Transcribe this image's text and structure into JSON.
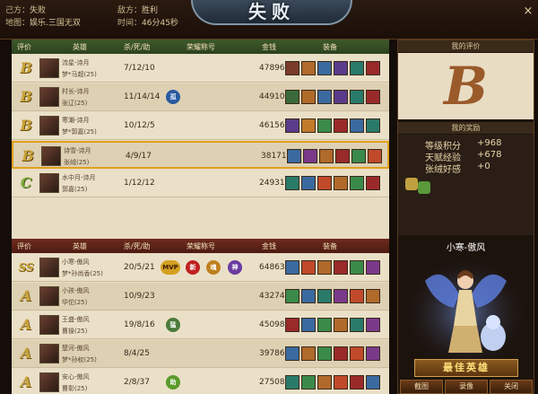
{
  "header": {
    "side_label": "己方：",
    "side_result": "失败",
    "enemy_label": "敌方：",
    "enemy_result": "胜利",
    "map_label": "地图：",
    "map_value": "娱乐.三国无双",
    "time_label": "时间：",
    "time_value": "46分45秒",
    "banner_title": "失败",
    "close_icon": "×"
  },
  "columns": {
    "rank": "评价",
    "hero": "英雄",
    "kda": "杀/死/助",
    "honor": "荣耀称号",
    "gold": "金钱",
    "equip": "装备"
  },
  "team_ally": [
    {
      "rank": "B",
      "player": "流星-诗月",
      "hero": "梦*马超(25)",
      "kda": "7/12/10",
      "gold": "47896"
    },
    {
      "rank": "B",
      "player": "村长-诗月",
      "hero": "张辽(25)",
      "kda": "11/14/14",
      "gold": "44910",
      "badge": "孤"
    },
    {
      "rank": "B",
      "player": "寒潮-诗月",
      "hero": "梦*郭嘉(25)",
      "kda": "10/12/5",
      "gold": "46156"
    },
    {
      "rank": "B",
      "player": "诗雪-诗月",
      "hero": "张绒(25)",
      "kda": "4/9/17",
      "gold": "38171"
    },
    {
      "rank": "C",
      "player": "水中月-诗月",
      "hero": "郭嘉(25)",
      "kda": "1/12/12",
      "gold": "24931"
    }
  ],
  "team_enemy": [
    {
      "rank": "SS",
      "player": "小寒-傲风",
      "hero": "梦*孙尚香(25)",
      "kda": "20/5/21",
      "gold": "64863",
      "badges": [
        "MVP",
        "新",
        "魂",
        "神"
      ]
    },
    {
      "rank": "A",
      "player": "小孩-傲风",
      "hero": "华佗(25)",
      "kda": "10/9/23",
      "gold": "43274"
    },
    {
      "rank": "A",
      "player": "王盛-傲风",
      "hero": "曹操(25)",
      "kda": "19/8/16",
      "gold": "45098",
      "badges": [
        "猛"
      ]
    },
    {
      "rank": "A",
      "player": "楚河-傲风",
      "hero": "梦*孙权(25)",
      "kda": "8/4/25",
      "gold": "39786"
    },
    {
      "rank": "A",
      "player": "安心-傲风",
      "hero": "曹彰(25)",
      "kda": "2/8/37",
      "gold": "27508",
      "badges": [
        "助"
      ]
    }
  ],
  "right_panel": {
    "my_rating_title": "我的评价",
    "my_rating": "B",
    "my_reward_title": "我的奖励",
    "rewards": [
      {
        "label": "等级积分",
        "value": "+968"
      },
      {
        "label": "天赋经验",
        "value": "+678"
      },
      {
        "label": "张绒好感",
        "value": "+0"
      }
    ],
    "mvp_hero_name": "小寒-傲风",
    "mvp_banner": "最佳英雄",
    "buttons": [
      "截图",
      "录像",
      "关闭"
    ]
  },
  "colors": {
    "panel_bg": "#e8dcc3",
    "ally_header": "#3e5a2a",
    "enemy_header": "#6e2a1e",
    "highlight_border": "#e0a020",
    "rank_gold": "#c9a43a"
  }
}
